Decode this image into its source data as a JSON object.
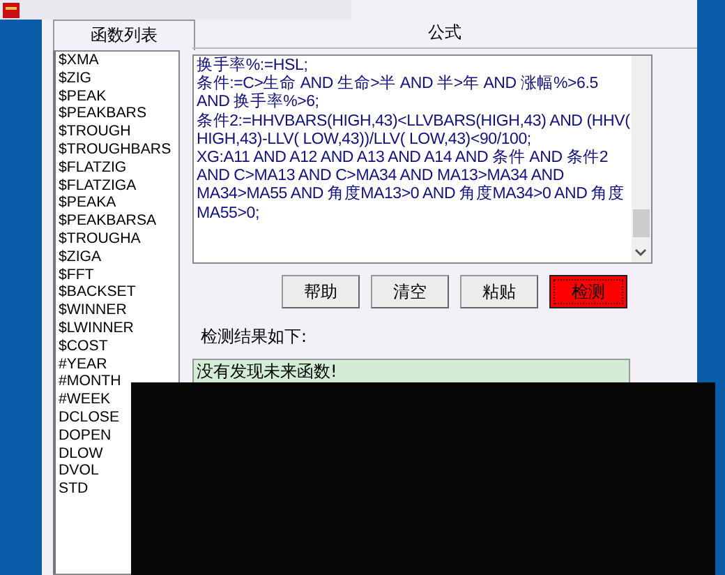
{
  "function_list": {
    "header": "函数列表",
    "items": [
      "$XMA",
      "$ZIG",
      "$PEAK",
      "$PEAKBARS",
      "$TROUGH",
      "$TROUGHBARS",
      "$FLATZIG",
      "$FLATZIGA",
      "$PEAKA",
      "$PEAKBARSA",
      "$TROUGHA",
      "$ZIGA",
      "$FFT",
      "$BACKSET",
      "$WINNER",
      "$LWINNER",
      "$COST",
      "#YEAR",
      "#MONTH",
      "#WEEK",
      "DCLOSE",
      "DOPEN",
      "DLOW",
      "DVOL",
      "STD"
    ]
  },
  "formula": {
    "header": "公式",
    "lines": [
      "换手率%:=HSL;",
      "条件:=C>生命 AND 生命>半 AND 半>年 AND 涨幅%>6.5",
      "AND 换手率%>6;",
      "条件2:=HHVBARS(HIGH,43)<LLVBARS(HIGH,43) AND (HHV(",
      "HIGH,43)-LLV( LOW,43))/LLV( LOW,43)<90/100;",
      "XG:A11 AND A12 AND A13 AND A14 AND 条件 AND 条件2",
      "AND C>MA13 AND C>MA34 AND MA13>MA34 AND",
      "MA34>MA55 AND 角度MA13>0 AND 角度MA34>0 AND 角度",
      "MA55>0;"
    ]
  },
  "buttons": [
    {
      "label": "帮助",
      "kind": "normal"
    },
    {
      "label": "清空",
      "kind": "normal"
    },
    {
      "label": "粘贴",
      "kind": "normal"
    },
    {
      "label": "检测",
      "kind": "primary"
    }
  ],
  "result": {
    "label": "检测结果如下:",
    "text": "没有发现未来函数!"
  }
}
